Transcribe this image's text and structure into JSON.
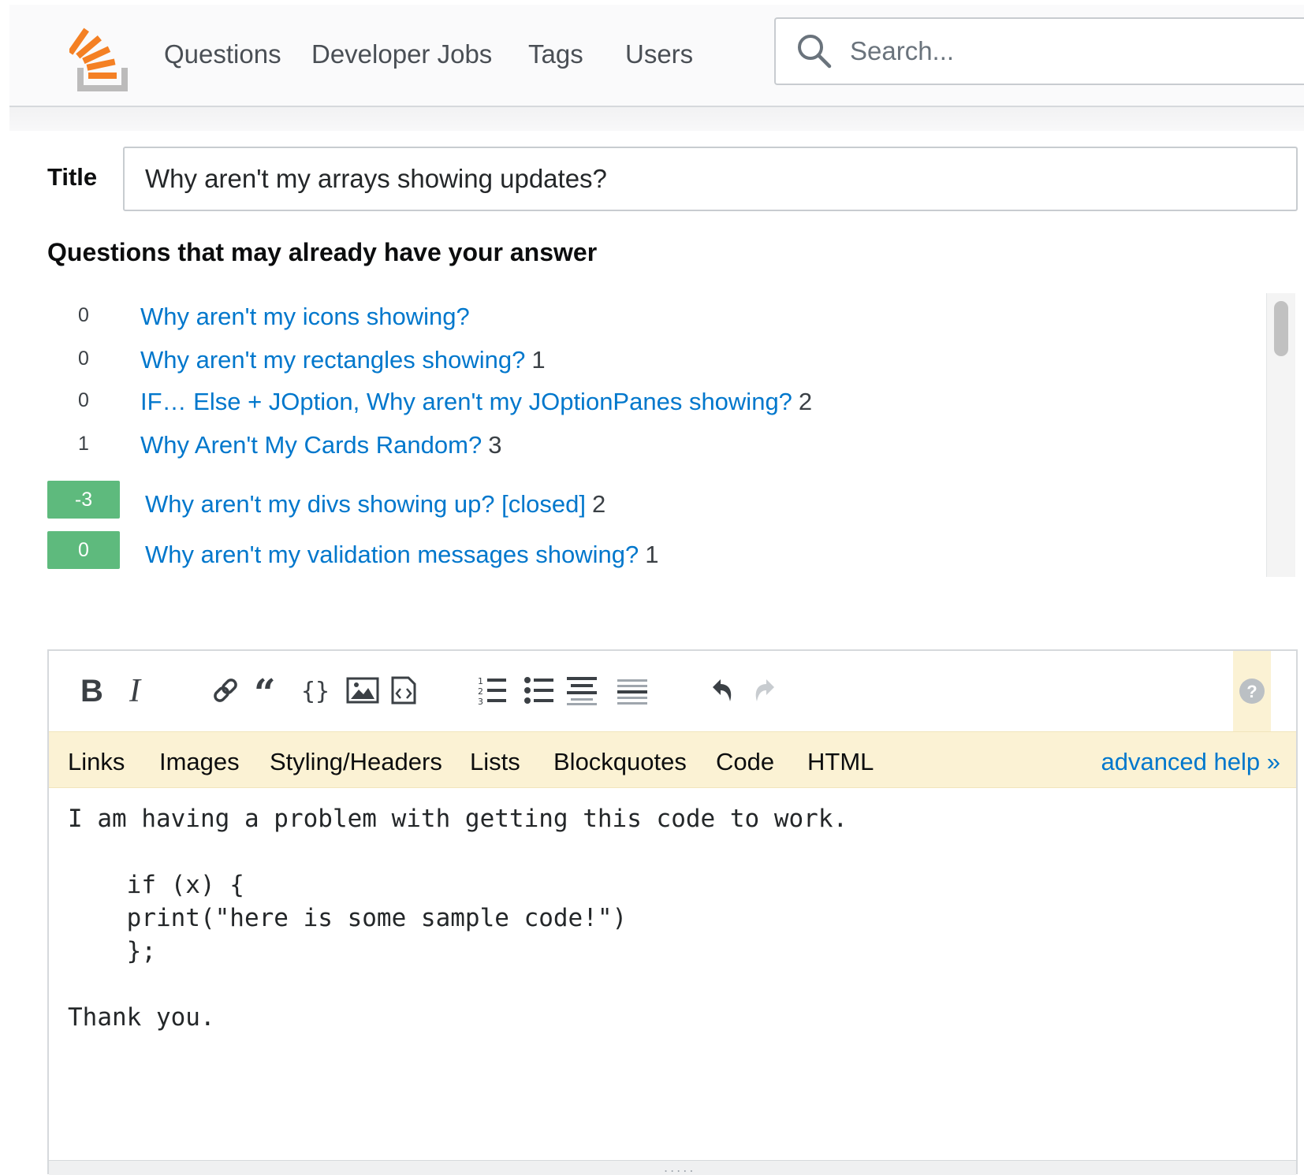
{
  "header": {
    "nav": [
      "Questions",
      "Developer Jobs",
      "Tags",
      "Users"
    ],
    "search_placeholder": "Search..."
  },
  "form": {
    "title_label": "Title",
    "title_value": "Why aren't my arrays showing updates?"
  },
  "similar": {
    "heading": "Questions that may already have your answer",
    "items": [
      {
        "votes": "0",
        "accepted": false,
        "title": "Why aren't my icons showing?",
        "answers": ""
      },
      {
        "votes": "0",
        "accepted": false,
        "title": "Why aren't my rectangles showing?",
        "answers": "1"
      },
      {
        "votes": "0",
        "accepted": false,
        "title": "IF… Else + JOption, Why aren't my JOptionPanes showing?",
        "answers": "2"
      },
      {
        "votes": "1",
        "accepted": false,
        "title": "Why Aren't My Cards Random?",
        "answers": "3"
      },
      {
        "votes": "-3",
        "accepted": true,
        "title": "Why aren't my divs showing up? [closed]",
        "answers": "2"
      },
      {
        "votes": "0",
        "accepted": true,
        "title": "Why aren't my validation messages showing?",
        "answers": "1"
      }
    ]
  },
  "editor": {
    "toolbar_icons": [
      "bold-icon",
      "italic-icon",
      "link-icon",
      "blockquote-icon",
      "code-icon",
      "image-icon",
      "snippet-icon",
      "numbered-list-icon",
      "bulleted-list-icon",
      "heading-icon",
      "horizontal-rule-icon",
      "undo-icon",
      "redo-icon",
      "help-icon"
    ],
    "help_tabs": [
      "Links",
      "Images",
      "Styling/Headers",
      "Lists",
      "Blockquotes",
      "Code",
      "HTML"
    ],
    "advanced_help": "advanced help »",
    "body": "I am having a problem with getting this code to work.\n\n    if (x) {\n    print(\"here is some sample code!\")\n    };\n\nThank you.",
    "grip": "....."
  },
  "colors": {
    "brand_orange": "#f48024",
    "link_blue": "#0077cc",
    "accepted_green": "#5eba7d",
    "help_bar_bg": "#fbf2d4"
  }
}
